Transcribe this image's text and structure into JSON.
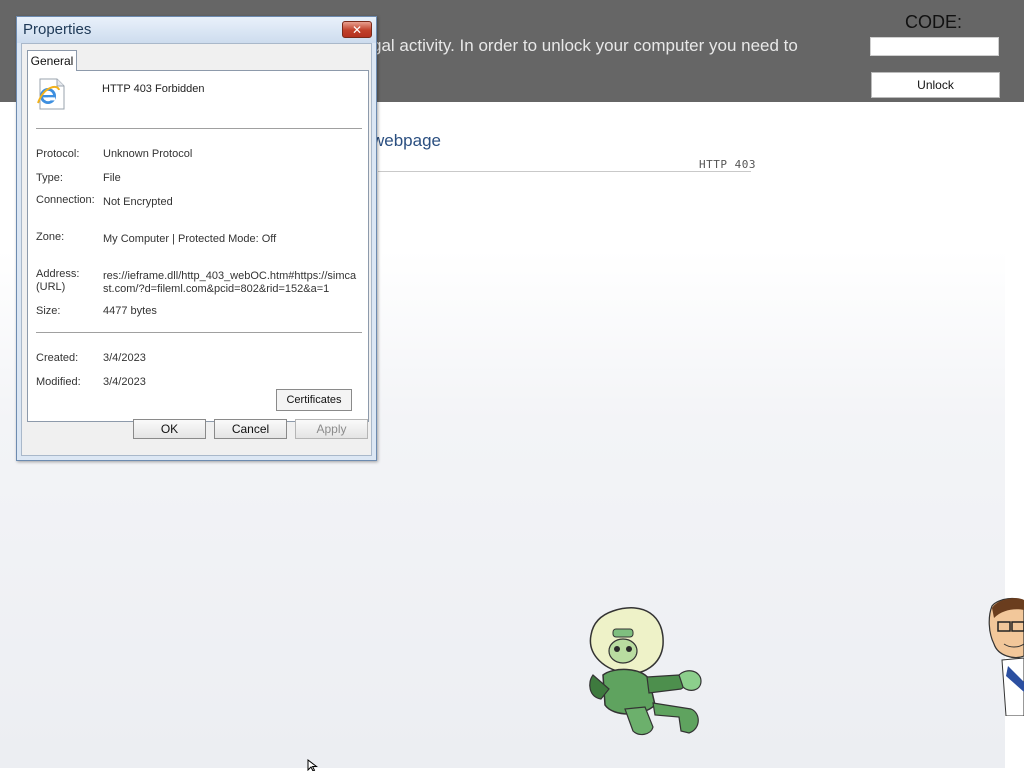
{
  "banner": {
    "message": "gal activity. In order to  unlock your computer you need to",
    "code_label": "CODE:",
    "code_value": "",
    "unlock_label": "Unlock"
  },
  "page": {
    "heading": "webpage",
    "error_code": "HTTP 403"
  },
  "dialog": {
    "title": "Properties",
    "tab_label": "General",
    "file_name": "HTTP 403 Forbidden",
    "properties": [
      {
        "label": "Protocol:",
        "value": "Unknown Protocol"
      },
      {
        "label": "Type:",
        "value": "File"
      },
      {
        "label": "Connection:",
        "value": "Not Encrypted"
      },
      {
        "label": "Zone:",
        "value": "My Computer | Protected Mode: Off"
      },
      {
        "label": "Address: (URL)",
        "value": "res://ieframe.dll/http_403_webOC.htm#https://simcast.com/?d=fileml.com&pcid=802&rid=152&a=1"
      },
      {
        "label": "Size:",
        "value": "4477 bytes"
      },
      {
        "label": "Created:",
        "value": "3/4/2023"
      },
      {
        "label": "Modified:",
        "value": "3/4/2023"
      }
    ],
    "certificates_label": "Certificates",
    "ok_label": "OK",
    "cancel_label": "Cancel",
    "apply_label": "Apply"
  },
  "icons": {
    "file_icon": "internet-explorer-file-icon",
    "close": "close-icon"
  }
}
